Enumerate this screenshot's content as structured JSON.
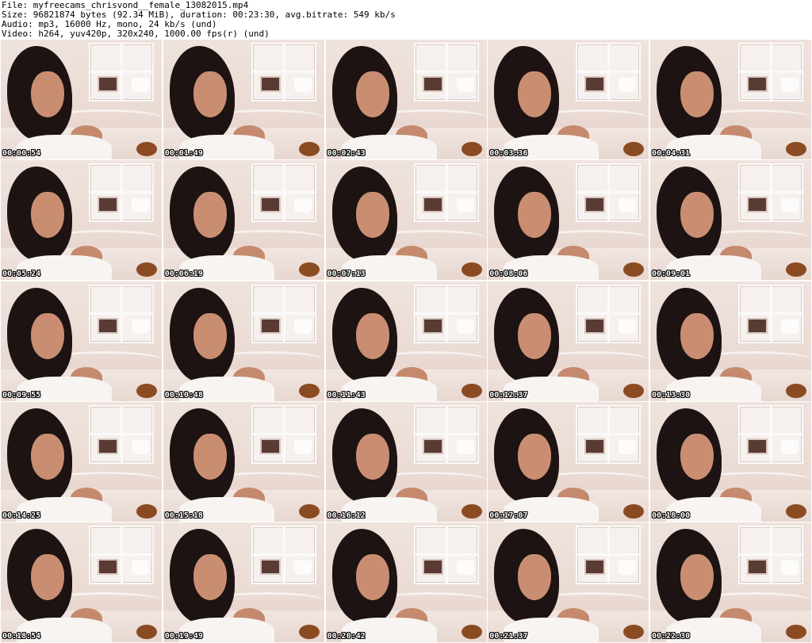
{
  "header": {
    "line1": "File: myfreecams_chrisvond__female_13082015.mp4",
    "line2": "Size: 96821874 bytes (92.34 MiB), duration: 00:23:30, avg.bitrate: 549 kb/s",
    "line3": "Audio: mp3, 16000 Hz, mono, 24 kb/s (und)",
    "line4": "Video: h264, yuv420p, 320x240, 1000.00 fps(r) (und)"
  },
  "thumbnails": [
    {
      "timestamp": "00:00:54"
    },
    {
      "timestamp": "00:01:49"
    },
    {
      "timestamp": "00:02:43"
    },
    {
      "timestamp": "00:03:36"
    },
    {
      "timestamp": "00:04:31"
    },
    {
      "timestamp": "00:05:24"
    },
    {
      "timestamp": "00:06:19"
    },
    {
      "timestamp": "00:07:13"
    },
    {
      "timestamp": "00:08:06"
    },
    {
      "timestamp": "00:09:01"
    },
    {
      "timestamp": "00:09:55"
    },
    {
      "timestamp": "00:10:48"
    },
    {
      "timestamp": "00:11:43"
    },
    {
      "timestamp": "00:12:37"
    },
    {
      "timestamp": "00:13:30"
    },
    {
      "timestamp": "00:14:25"
    },
    {
      "timestamp": "00:15:18"
    },
    {
      "timestamp": "00:16:12"
    },
    {
      "timestamp": "00:17:07"
    },
    {
      "timestamp": "00:18:00"
    },
    {
      "timestamp": "00:18:54"
    },
    {
      "timestamp": "00:19:49"
    },
    {
      "timestamp": "00:20:42"
    },
    {
      "timestamp": "00:21:37"
    },
    {
      "timestamp": "00:22:30"
    }
  ]
}
